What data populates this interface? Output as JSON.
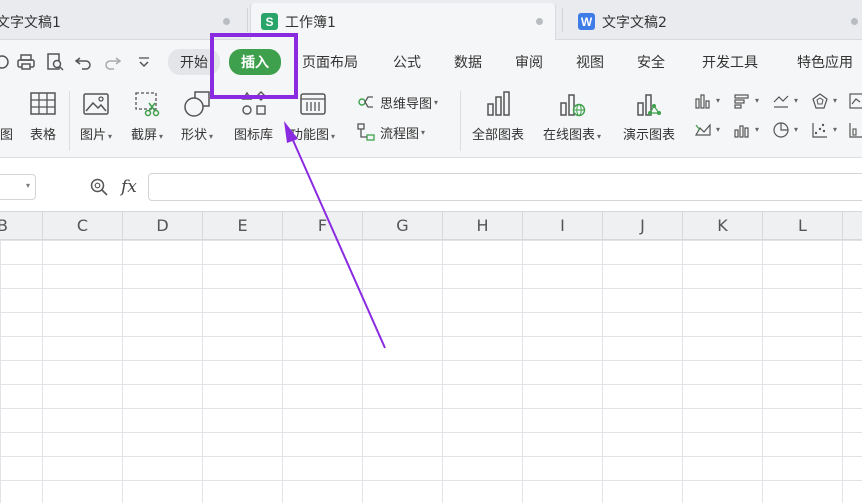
{
  "tabs": [
    {
      "label": "文字文稿1",
      "icon": "document-icon"
    },
    {
      "label": "工作簿1",
      "icon": "spreadsheet-icon",
      "badge": "S",
      "badge_color": "#2aa56a"
    },
    {
      "label": "文字文稿2",
      "icon": "writer-icon",
      "badge": "W",
      "badge_color": "#3e7ce8"
    }
  ],
  "menu": {
    "start": "开始",
    "insert": "插入",
    "page_layout": "页面布局",
    "formula": "公式",
    "data": "数据",
    "review": "审阅",
    "view": "视图",
    "security": "安全",
    "developer": "开发工具",
    "special": "特色应用"
  },
  "ribbon": {
    "pivot_chart": "图",
    "table": "表格",
    "picture": "图片",
    "screenshot": "截屏",
    "shape": "形状",
    "icon_library": "图标库",
    "function_chart": "功能图",
    "mind_map": "思维导图",
    "flowchart": "流程图",
    "all_charts": "全部图表",
    "online_charts": "在线图表",
    "demo_charts": "演示图表"
  },
  "formula_bar": {
    "fx_label": "fx",
    "value": ""
  },
  "columns": [
    "B",
    "C",
    "D",
    "E",
    "F",
    "G",
    "H",
    "I",
    "J",
    "K",
    "L"
  ],
  "colors": {
    "accent": "#3ea04c",
    "annotation": "#8a2be2"
  }
}
